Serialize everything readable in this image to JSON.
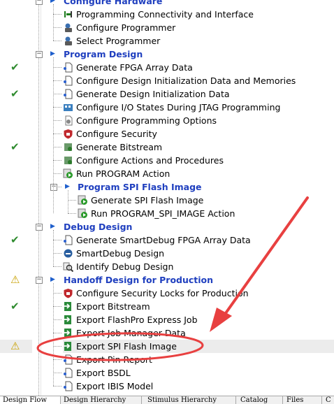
{
  "tree": {
    "sections": [
      {
        "title": "Configure Hardware",
        "items": [
          {
            "label": "Programming Connectivity and Interface",
            "icon": "connectivity-icon",
            "status": ""
          },
          {
            "label": "Configure Programmer",
            "icon": "programmer-icon",
            "status": ""
          },
          {
            "label": "Select Programmer",
            "icon": "programmer-icon",
            "status": ""
          }
        ]
      },
      {
        "title": "Program Design",
        "items": [
          {
            "label": "Generate FPGA Array Data",
            "icon": "document-icon",
            "status": "done"
          },
          {
            "label": "Configure Design Initialization Data and Memories",
            "icon": "document-icon",
            "status": ""
          },
          {
            "label": "Generate Design Initialization Data",
            "icon": "document-icon",
            "status": "done"
          },
          {
            "label": "Configure I/O States During JTAG Programming",
            "icon": "io-states-icon",
            "status": ""
          },
          {
            "label": "Configure Programming Options",
            "icon": "gear-icon",
            "status": ""
          },
          {
            "label": "Configure Security",
            "icon": "shield-icon",
            "status": ""
          },
          {
            "label": "Generate Bitstream",
            "icon": "bitstream-icon",
            "status": "done"
          },
          {
            "label": "Configure Actions and Procedures",
            "icon": "bitstream-icon",
            "status": ""
          },
          {
            "label": "Run PROGRAM Action",
            "icon": "run-icon",
            "status": ""
          }
        ],
        "subsection": {
          "title": "Program SPI Flash Image",
          "items": [
            {
              "label": "Generate SPI Flash Image",
              "icon": "run-icon"
            },
            {
              "label": "Run PROGRAM_SPI_IMAGE Action",
              "icon": "run-icon"
            }
          ]
        }
      },
      {
        "title": "Debug Design",
        "items": [
          {
            "label": "Generate SmartDebug FPGA Array Data",
            "icon": "document-icon",
            "status": "done"
          },
          {
            "label": "SmartDebug Design",
            "icon": "smartdebug-icon",
            "status": ""
          },
          {
            "label": "Identify Debug Design",
            "icon": "identify-icon",
            "status": ""
          }
        ]
      },
      {
        "title": "Handoff Design for Production",
        "status": "warning",
        "items": [
          {
            "label": "Configure Security Locks for Production",
            "icon": "shield-icon",
            "status": ""
          },
          {
            "label": "Export Bitstream",
            "icon": "export-icon",
            "status": "done"
          },
          {
            "label": "Export FlashPro Express Job",
            "icon": "export-icon",
            "status": ""
          },
          {
            "label": "Export Job Manager Data",
            "icon": "export-icon",
            "status": ""
          },
          {
            "label": "Export SPI Flash Image",
            "icon": "export-icon",
            "status": "warning",
            "selected": true
          },
          {
            "label": "Export Pin Report",
            "icon": "document-icon",
            "status": ""
          },
          {
            "label": "Export BSDL",
            "icon": "document-icon",
            "status": ""
          },
          {
            "label": "Export IBIS Model",
            "icon": "document-icon",
            "status": ""
          }
        ]
      }
    ]
  },
  "tabs": [
    "Design Flow",
    "Design Hierarchy",
    "Stimulus Hierarchy",
    "Catalog",
    "Files",
    "C"
  ],
  "status_symbols": {
    "done": "✔",
    "warning": "⚠"
  },
  "colors": {
    "section_header": "#1f3fbf",
    "check": "#2e8b2e",
    "warning": "#c8a000",
    "annotation": "#e84040"
  }
}
